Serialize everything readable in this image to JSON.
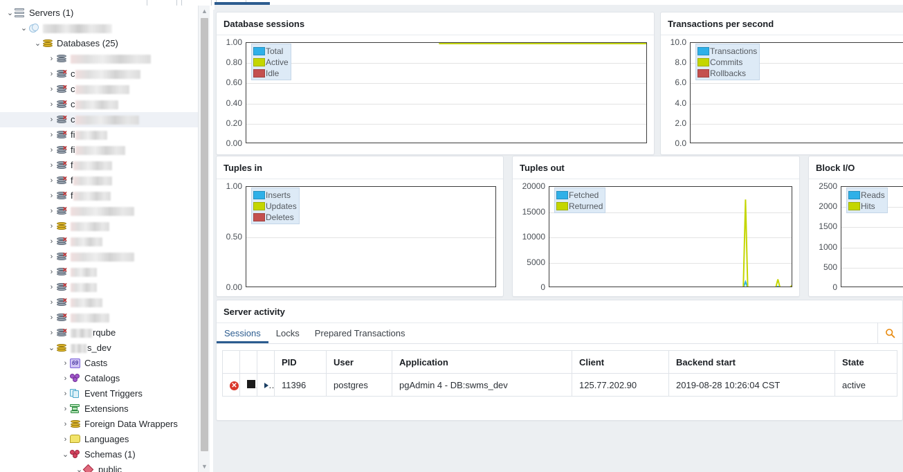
{
  "toolbar": {
    "buttons": [
      "",
      "",
      ""
    ]
  },
  "tree": {
    "scrollbar": {
      "up_arrow": "▲",
      "down_arrow": "▼"
    },
    "items": [
      {
        "id": "servers",
        "depth": 0,
        "twisty": "⌄",
        "icon": "servers-icon",
        "label": "Servers (1)",
        "redact": 0
      },
      {
        "id": "server",
        "depth": 1,
        "twisty": "⌄",
        "icon": "postgresql-icon",
        "label": "",
        "redact": 100
      },
      {
        "id": "databases",
        "depth": 2,
        "twisty": "⌄",
        "icon": "database-group-icon",
        "label": "Databases (25)",
        "redact": 0
      },
      {
        "id": "db-1",
        "depth": 3,
        "twisty": "›",
        "icon": "database-icon-grey",
        "label": "",
        "redact": 116
      },
      {
        "id": "db-2",
        "depth": 3,
        "twisty": "›",
        "icon": "database-icon-x",
        "label": "c",
        "redact": 94
      },
      {
        "id": "db-3",
        "depth": 3,
        "twisty": "›",
        "icon": "database-icon-x",
        "label": "c",
        "redact": 78
      },
      {
        "id": "db-4",
        "depth": 3,
        "twisty": "›",
        "icon": "database-icon-x",
        "label": "c",
        "redact": 62
      },
      {
        "id": "db-5",
        "depth": 3,
        "twisty": "›",
        "icon": "database-icon-x",
        "label": "c",
        "redact": 92,
        "selected": true
      },
      {
        "id": "db-6",
        "depth": 3,
        "twisty": "›",
        "icon": "database-icon-x",
        "label": "fi",
        "redact": 46
      },
      {
        "id": "db-7",
        "depth": 3,
        "twisty": "›",
        "icon": "database-icon-x",
        "label": "fi",
        "redact": 72
      },
      {
        "id": "db-8",
        "depth": 3,
        "twisty": "›",
        "icon": "database-icon-x",
        "label": "f",
        "redact": 56
      },
      {
        "id": "db-9",
        "depth": 3,
        "twisty": "›",
        "icon": "database-icon-x",
        "label": "f",
        "redact": 56
      },
      {
        "id": "db-10",
        "depth": 3,
        "twisty": "›",
        "icon": "database-icon-x",
        "label": "f",
        "redact": 54
      },
      {
        "id": "db-11",
        "depth": 3,
        "twisty": "›",
        "icon": "database-icon-x",
        "label": "",
        "redact": 92
      },
      {
        "id": "db-12",
        "depth": 3,
        "twisty": "›",
        "icon": "database-icon-gold",
        "label": "",
        "redact": 56
      },
      {
        "id": "db-13",
        "depth": 3,
        "twisty": "›",
        "icon": "database-icon-x",
        "label": "",
        "redact": 46
      },
      {
        "id": "db-14",
        "depth": 3,
        "twisty": "›",
        "icon": "database-icon-x",
        "label": "",
        "redact": 92
      },
      {
        "id": "db-15",
        "depth": 3,
        "twisty": "›",
        "icon": "database-icon-x",
        "label": "",
        "redact": 38
      },
      {
        "id": "db-16",
        "depth": 3,
        "twisty": "›",
        "icon": "database-icon-x",
        "label": "",
        "redact": 38
      },
      {
        "id": "db-17",
        "depth": 3,
        "twisty": "›",
        "icon": "database-icon-x",
        "label": "",
        "redact": 46
      },
      {
        "id": "db-18",
        "depth": 3,
        "twisty": "›",
        "icon": "database-icon-x",
        "label": "",
        "redact": 56
      },
      {
        "id": "db-19",
        "depth": 3,
        "twisty": "›",
        "icon": "database-icon-x",
        "label": "rqube",
        "redact": 32,
        "redact_before": true
      },
      {
        "id": "db-20",
        "depth": 3,
        "twisty": "⌄",
        "icon": "database-icon-gold",
        "label": "s_dev",
        "redact": 24,
        "redact_before": true
      },
      {
        "id": "casts",
        "depth": 4,
        "twisty": "›",
        "icon": "casts-icon",
        "label": "Casts",
        "redact": 0
      },
      {
        "id": "catalogs",
        "depth": 4,
        "twisty": "›",
        "icon": "catalogs-icon",
        "label": "Catalogs",
        "redact": 0
      },
      {
        "id": "event-triggers",
        "depth": 4,
        "twisty": "›",
        "icon": "event-triggers-icon",
        "label": "Event Triggers",
        "redact": 0
      },
      {
        "id": "extensions",
        "depth": 4,
        "twisty": "›",
        "icon": "extensions-icon",
        "label": "Extensions",
        "redact": 0
      },
      {
        "id": "fdw",
        "depth": 4,
        "twisty": "›",
        "icon": "foreign-data-wrappers-icon",
        "label": "Foreign Data Wrappers",
        "redact": 0
      },
      {
        "id": "languages",
        "depth": 4,
        "twisty": "›",
        "icon": "languages-icon",
        "label": "Languages",
        "redact": 0
      },
      {
        "id": "schemas",
        "depth": 4,
        "twisty": "⌄",
        "icon": "schemas-icon",
        "label": "Schemas (1)",
        "redact": 0
      },
      {
        "id": "public",
        "depth": 5,
        "twisty": "⌄",
        "icon": "public-schema-icon",
        "label": "public",
        "redact": 0
      }
    ]
  },
  "colors": {
    "series_blue": "#2fb0e8",
    "series_yellow": "#c4d600",
    "series_red": "#c4504f",
    "accent": "#2c5c8f",
    "search_icon": "#e8890c"
  },
  "charts": [
    {
      "key": "database_sessions",
      "title": "Database sessions",
      "chart_data": {
        "type": "line",
        "title": "Database sessions",
        "xlabel": "",
        "ylabel": "",
        "ylim": [
          0,
          1.0
        ],
        "yticks": [
          "0.00",
          "0.20",
          "0.40",
          "0.60",
          "0.80",
          "1.00"
        ],
        "grid": true,
        "legend_position": "top-left",
        "series": [
          {
            "name": "Total",
            "color": "#2fb0e8",
            "values": []
          },
          {
            "name": "Active",
            "color": "#c4d600",
            "values": [
              1.0,
              1.0,
              1.0,
              1.0
            ],
            "x_start_pct": 48,
            "level": 1.0
          },
          {
            "name": "Idle",
            "color": "#c4504f",
            "values": [
              0.0,
              0.0,
              0.0,
              0.0
            ],
            "x_start_pct": 48,
            "level": 0.0
          }
        ]
      }
    },
    {
      "key": "transactions_per_second",
      "title": "Transactions per second",
      "chart_data": {
        "type": "line",
        "title": "Transactions per second",
        "xlabel": "",
        "ylabel": "",
        "ylim": [
          0,
          10.0
        ],
        "yticks": [
          "0.0",
          "2.0",
          "4.0",
          "6.0",
          "8.0",
          "10.0"
        ],
        "grid": true,
        "legend_position": "top-left",
        "series": [
          {
            "name": "Transactions",
            "color": "#2fb0e8",
            "values": []
          },
          {
            "name": "Commits",
            "color": "#c4d600",
            "values": []
          },
          {
            "name": "Rollbacks",
            "color": "#c4504f",
            "values": []
          }
        ]
      }
    },
    {
      "key": "tuples_in",
      "title": "Tuples in",
      "chart_data": {
        "type": "line",
        "title": "Tuples in",
        "xlabel": "",
        "ylabel": "",
        "ylim": [
          0,
          1.0
        ],
        "yticks": [
          "0.00",
          "0.50",
          "1.00"
        ],
        "grid": true,
        "legend_position": "top-left",
        "series": [
          {
            "name": "Inserts",
            "color": "#2fb0e8",
            "values": []
          },
          {
            "name": "Updates",
            "color": "#c4d600",
            "values": []
          },
          {
            "name": "Deletes",
            "color": "#c4504f",
            "values": [
              0.0,
              0.0,
              0.0
            ],
            "x_start_pct": 80,
            "level": 0.0
          }
        ]
      }
    },
    {
      "key": "tuples_out",
      "title": "Tuples out",
      "chart_data": {
        "type": "line",
        "title": "Tuples out",
        "xlabel": "",
        "ylabel": "",
        "ylim": [
          0,
          20000
        ],
        "yticks": [
          "0",
          "5000",
          "10000",
          "15000",
          "20000"
        ],
        "grid": true,
        "legend_position": "top-left",
        "series": [
          {
            "name": "Fetched",
            "color": "#2fb0e8",
            "peaks": [
              {
                "x_pct": 80.5,
                "value": 1200
              },
              {
                "x_pct": 93.8,
                "value": 300
              },
              {
                "x_pct": 99.5,
                "value": 250
              }
            ]
          },
          {
            "name": "Returned",
            "color": "#c4d600",
            "peaks": [
              {
                "x_pct": 80.5,
                "value": 17500
              },
              {
                "x_pct": 93.8,
                "value": 1700
              },
              {
                "x_pct": 99.5,
                "value": 450
              }
            ]
          }
        ]
      }
    },
    {
      "key": "block_io",
      "title": "Block I/O",
      "chart_data": {
        "type": "line",
        "title": "Block I/O",
        "xlabel": "",
        "ylabel": "",
        "ylim": [
          0,
          2500
        ],
        "yticks": [
          "0",
          "500",
          "1000",
          "1500",
          "2000",
          "2500"
        ],
        "grid": true,
        "legend_position": "top-left",
        "series": [
          {
            "name": "Reads",
            "color": "#2fb0e8",
            "values": []
          },
          {
            "name": "Hits",
            "color": "#c4d600",
            "values": []
          }
        ]
      }
    }
  ],
  "server_activity": {
    "title": "Server activity",
    "tabs": [
      {
        "id": "sessions",
        "label": "Sessions",
        "active": true
      },
      {
        "id": "locks",
        "label": "Locks",
        "active": false
      },
      {
        "id": "prepared",
        "label": "Prepared Transactions",
        "active": false
      }
    ],
    "search_icon": "search-icon",
    "columns": [
      "",
      "",
      "",
      "PID",
      "User",
      "Application",
      "Client",
      "Backend start",
      "State"
    ],
    "rows": [
      {
        "cancel": "cancel-icon",
        "terminate": "terminate-icon",
        "expand": "expand-caret-icon",
        "pid": "11396",
        "user": "postgres",
        "application": "pgAdmin 4 - DB:swms_dev",
        "client": "125.77.202.90",
        "backend_start": "2019-08-28 10:26:04 CST",
        "state": "active"
      }
    ]
  }
}
